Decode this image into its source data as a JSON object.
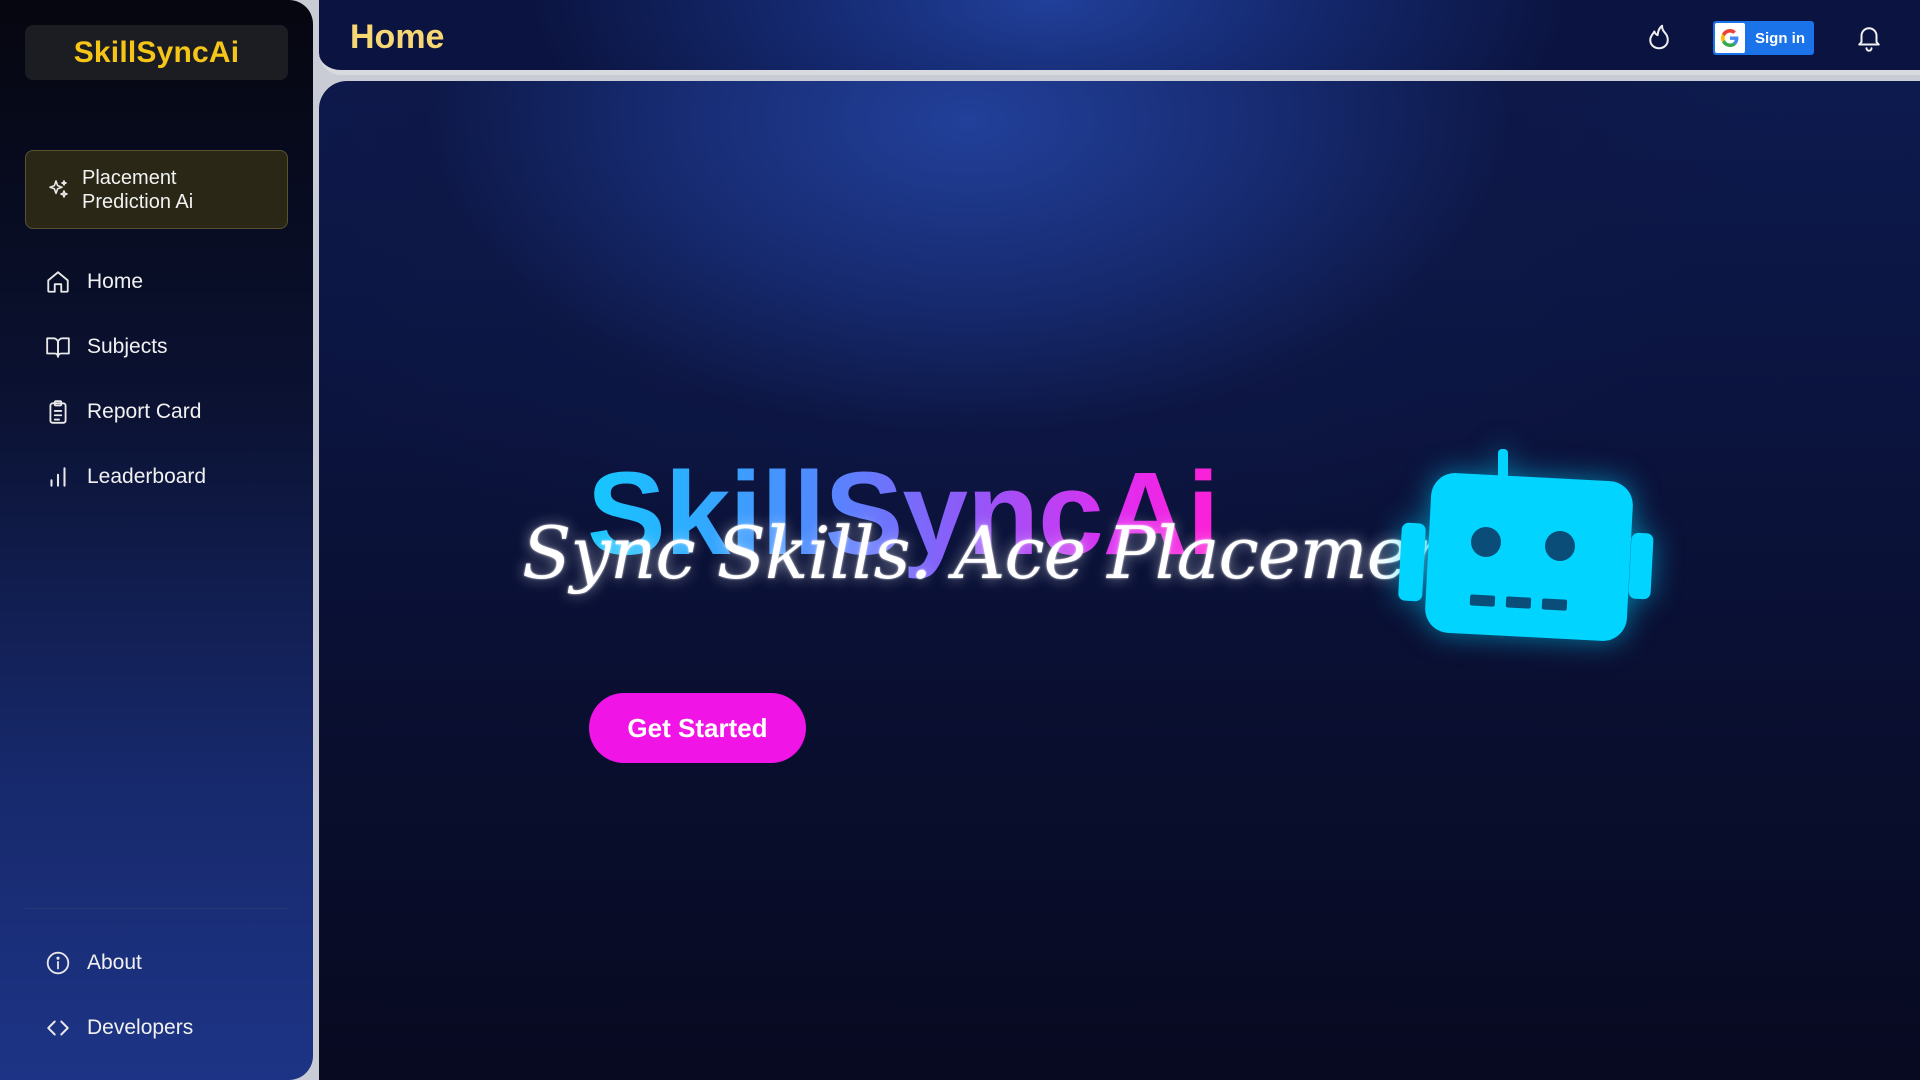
{
  "sidebar": {
    "brand": "SkillSyncAi",
    "promo_label": "Placement Prediction Ai",
    "items": [
      {
        "label": "Home",
        "icon": "home-icon"
      },
      {
        "label": "Subjects",
        "icon": "book-icon"
      },
      {
        "label": "Report Card",
        "icon": "clipboard-icon"
      },
      {
        "label": "Leaderboard",
        "icon": "bar-chart-icon"
      }
    ],
    "bottom_items": [
      {
        "label": "About",
        "icon": "info-icon"
      },
      {
        "label": "Developers",
        "icon": "code-icon"
      }
    ]
  },
  "header": {
    "title": "Home",
    "signin_label": "Sign in",
    "icons": [
      "flame-icon",
      "google-icon",
      "bell-icon"
    ]
  },
  "hero": {
    "title": "SkillSyncAi",
    "tagline": "Sync Skills. Ace Placements.",
    "cta_label": "Get Started",
    "illustration": "robot-icon"
  },
  "colors": {
    "brand_yellow": "#f5c518",
    "title_yellow": "#f7d774",
    "cta_magenta": "#f014e6",
    "robot_cyan": "#00d4ff",
    "gradient_start": "#14c8ff",
    "gradient_end": "#ff1fd6",
    "google_blue": "#1a73e8"
  }
}
